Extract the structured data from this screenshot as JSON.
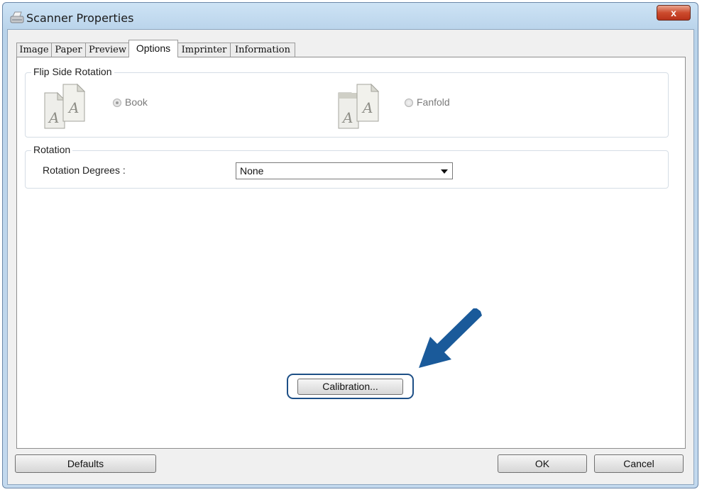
{
  "window": {
    "title": "Scanner Properties",
    "close_glyph": "x"
  },
  "tabs": [
    {
      "label": "Image"
    },
    {
      "label": "Paper"
    },
    {
      "label": "Preview"
    },
    {
      "label": "Options",
      "active": true
    },
    {
      "label": "Imprinter"
    },
    {
      "label": "Information"
    }
  ],
  "flip_side": {
    "title": "Flip Side Rotation",
    "book": {
      "label": "Book",
      "selected": true,
      "enabled": false,
      "icon": "book-pages-icon"
    },
    "fanfold": {
      "label": "Fanfold",
      "selected": false,
      "enabled": false,
      "icon": "fanfold-pages-icon"
    }
  },
  "rotation": {
    "title": "Rotation",
    "degrees_label": "Rotation Degrees :",
    "degrees_value": "None"
  },
  "calibration_button": "Calibration...",
  "footer": {
    "defaults": "Defaults",
    "ok": "OK",
    "cancel": "Cancel"
  },
  "colors": {
    "accent_arrow": "#1a5a9a",
    "highlight_border": "#1d4f86"
  }
}
